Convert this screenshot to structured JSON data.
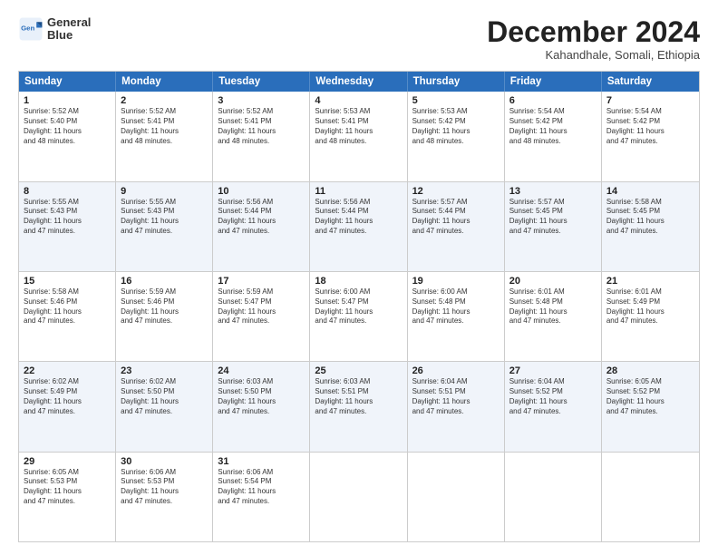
{
  "logo": {
    "line1": "General",
    "line2": "Blue"
  },
  "title": "December 2024",
  "subtitle": "Kahandhale, Somali, Ethiopia",
  "header": {
    "days": [
      "Sunday",
      "Monday",
      "Tuesday",
      "Wednesday",
      "Thursday",
      "Friday",
      "Saturday"
    ]
  },
  "rows": [
    {
      "alt": false,
      "cells": [
        {
          "day": "1",
          "info": "Sunrise: 5:52 AM\nSunset: 5:40 PM\nDaylight: 11 hours\nand 48 minutes."
        },
        {
          "day": "2",
          "info": "Sunrise: 5:52 AM\nSunset: 5:41 PM\nDaylight: 11 hours\nand 48 minutes."
        },
        {
          "day": "3",
          "info": "Sunrise: 5:52 AM\nSunset: 5:41 PM\nDaylight: 11 hours\nand 48 minutes."
        },
        {
          "day": "4",
          "info": "Sunrise: 5:53 AM\nSunset: 5:41 PM\nDaylight: 11 hours\nand 48 minutes."
        },
        {
          "day": "5",
          "info": "Sunrise: 5:53 AM\nSunset: 5:42 PM\nDaylight: 11 hours\nand 48 minutes."
        },
        {
          "day": "6",
          "info": "Sunrise: 5:54 AM\nSunset: 5:42 PM\nDaylight: 11 hours\nand 48 minutes."
        },
        {
          "day": "7",
          "info": "Sunrise: 5:54 AM\nSunset: 5:42 PM\nDaylight: 11 hours\nand 47 minutes."
        }
      ]
    },
    {
      "alt": true,
      "cells": [
        {
          "day": "8",
          "info": "Sunrise: 5:55 AM\nSunset: 5:43 PM\nDaylight: 11 hours\nand 47 minutes."
        },
        {
          "day": "9",
          "info": "Sunrise: 5:55 AM\nSunset: 5:43 PM\nDaylight: 11 hours\nand 47 minutes."
        },
        {
          "day": "10",
          "info": "Sunrise: 5:56 AM\nSunset: 5:44 PM\nDaylight: 11 hours\nand 47 minutes."
        },
        {
          "day": "11",
          "info": "Sunrise: 5:56 AM\nSunset: 5:44 PM\nDaylight: 11 hours\nand 47 minutes."
        },
        {
          "day": "12",
          "info": "Sunrise: 5:57 AM\nSunset: 5:44 PM\nDaylight: 11 hours\nand 47 minutes."
        },
        {
          "day": "13",
          "info": "Sunrise: 5:57 AM\nSunset: 5:45 PM\nDaylight: 11 hours\nand 47 minutes."
        },
        {
          "day": "14",
          "info": "Sunrise: 5:58 AM\nSunset: 5:45 PM\nDaylight: 11 hours\nand 47 minutes."
        }
      ]
    },
    {
      "alt": false,
      "cells": [
        {
          "day": "15",
          "info": "Sunrise: 5:58 AM\nSunset: 5:46 PM\nDaylight: 11 hours\nand 47 minutes."
        },
        {
          "day": "16",
          "info": "Sunrise: 5:59 AM\nSunset: 5:46 PM\nDaylight: 11 hours\nand 47 minutes."
        },
        {
          "day": "17",
          "info": "Sunrise: 5:59 AM\nSunset: 5:47 PM\nDaylight: 11 hours\nand 47 minutes."
        },
        {
          "day": "18",
          "info": "Sunrise: 6:00 AM\nSunset: 5:47 PM\nDaylight: 11 hours\nand 47 minutes."
        },
        {
          "day": "19",
          "info": "Sunrise: 6:00 AM\nSunset: 5:48 PM\nDaylight: 11 hours\nand 47 minutes."
        },
        {
          "day": "20",
          "info": "Sunrise: 6:01 AM\nSunset: 5:48 PM\nDaylight: 11 hours\nand 47 minutes."
        },
        {
          "day": "21",
          "info": "Sunrise: 6:01 AM\nSunset: 5:49 PM\nDaylight: 11 hours\nand 47 minutes."
        }
      ]
    },
    {
      "alt": true,
      "cells": [
        {
          "day": "22",
          "info": "Sunrise: 6:02 AM\nSunset: 5:49 PM\nDaylight: 11 hours\nand 47 minutes."
        },
        {
          "day": "23",
          "info": "Sunrise: 6:02 AM\nSunset: 5:50 PM\nDaylight: 11 hours\nand 47 minutes."
        },
        {
          "day": "24",
          "info": "Sunrise: 6:03 AM\nSunset: 5:50 PM\nDaylight: 11 hours\nand 47 minutes."
        },
        {
          "day": "25",
          "info": "Sunrise: 6:03 AM\nSunset: 5:51 PM\nDaylight: 11 hours\nand 47 minutes."
        },
        {
          "day": "26",
          "info": "Sunrise: 6:04 AM\nSunset: 5:51 PM\nDaylight: 11 hours\nand 47 minutes."
        },
        {
          "day": "27",
          "info": "Sunrise: 6:04 AM\nSunset: 5:52 PM\nDaylight: 11 hours\nand 47 minutes."
        },
        {
          "day": "28",
          "info": "Sunrise: 6:05 AM\nSunset: 5:52 PM\nDaylight: 11 hours\nand 47 minutes."
        }
      ]
    },
    {
      "alt": false,
      "cells": [
        {
          "day": "29",
          "info": "Sunrise: 6:05 AM\nSunset: 5:53 PM\nDaylight: 11 hours\nand 47 minutes."
        },
        {
          "day": "30",
          "info": "Sunrise: 6:06 AM\nSunset: 5:53 PM\nDaylight: 11 hours\nand 47 minutes."
        },
        {
          "day": "31",
          "info": "Sunrise: 6:06 AM\nSunset: 5:54 PM\nDaylight: 11 hours\nand 47 minutes."
        },
        {
          "day": "",
          "info": ""
        },
        {
          "day": "",
          "info": ""
        },
        {
          "day": "",
          "info": ""
        },
        {
          "day": "",
          "info": ""
        }
      ]
    }
  ]
}
